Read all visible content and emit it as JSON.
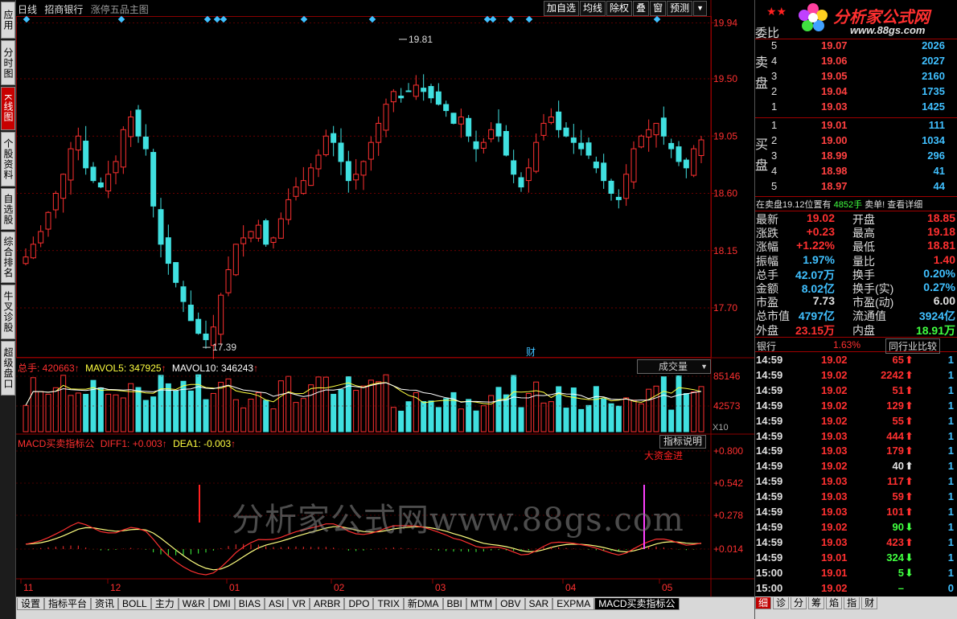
{
  "sidebar": {
    "items": [
      {
        "label": "应用",
        "active": false
      },
      {
        "label": "分时图",
        "active": false
      },
      {
        "label": "K线图",
        "active": true
      },
      {
        "label": "个股资料",
        "active": false
      },
      {
        "label": "自选股",
        "active": false
      },
      {
        "label": "综合排名",
        "active": false
      },
      {
        "label": "牛叉诊股",
        "active": false
      },
      {
        "label": "超级盘口",
        "active": false
      }
    ]
  },
  "header": {
    "period": "日线",
    "stock_name": "招商银行",
    "template_name": "涨停五品主图"
  },
  "toolbar": {
    "buttons": [
      "加自选",
      "均线",
      "除权",
      "叠",
      "窗",
      "预测"
    ],
    "dropdown_icon": "triangle-down-icon"
  },
  "price_axis": [
    "19.94",
    "19.50",
    "19.05",
    "18.60",
    "18.15",
    "17.70"
  ],
  "price_annotations": {
    "high_label": "19.81",
    "low_label": "17.39",
    "finance_marker": "财"
  },
  "volume_panel": {
    "label": "总手: 420663",
    "mavol5": "MAVOL5: 347925",
    "mavol10": "MAVOL10: 346243",
    "axis": [
      "85146",
      "42573"
    ],
    "unit": "X10",
    "selector": "成交量"
  },
  "macd_panel": {
    "label": "MACD买卖指标公",
    "diff": "DIFF1: +0.003",
    "dea": "DEA1: -0.003",
    "axis": [
      "+0.800",
      "+0.542",
      "+0.278",
      "+0.014"
    ],
    "help_button": "指标说明",
    "signal_text": "大资金进",
    "watermark": "分析家公式网www.88gs.com"
  },
  "x_axis": [
    "11",
    "12",
    "01",
    "02",
    "03",
    "04",
    "05"
  ],
  "bottom_tabs": [
    "设置",
    "指标平台",
    "资讯",
    "BOLL",
    "主力",
    "W&R",
    "DMI",
    "BIAS",
    "ASI",
    "VR",
    "ARBR",
    "DPO",
    "TRIX",
    "新DMA",
    "BBI",
    "MTM",
    "OBV",
    "SAR",
    "EXPMA",
    "MACD买卖指标公"
  ],
  "bottom_tabs_active": "MACD买卖指标公",
  "brand": {
    "name": "分析家公式网",
    "url": "www.88gs.com",
    "stars": "★★"
  },
  "order_book": {
    "commission_label": "委比",
    "sell_label": "卖盘",
    "buy_label": "买盘",
    "asks": [
      {
        "level": "5",
        "price": "19.07",
        "volume": "2026"
      },
      {
        "level": "4",
        "price": "19.06",
        "volume": "2027"
      },
      {
        "level": "3",
        "price": "19.05",
        "volume": "2160"
      },
      {
        "level": "2",
        "price": "19.04",
        "volume": "1735"
      },
      {
        "level": "1",
        "price": "19.03",
        "volume": "1425"
      }
    ],
    "bids": [
      {
        "level": "1",
        "price": "19.01",
        "volume": "111"
      },
      {
        "level": "2",
        "price": "19.00",
        "volume": "1034"
      },
      {
        "level": "3",
        "price": "18.99",
        "volume": "296"
      },
      {
        "level": "4",
        "price": "18.98",
        "volume": "41"
      },
      {
        "level": "5",
        "price": "18.97",
        "volume": "44"
      }
    ],
    "notice_prefix": "在卖盘19.12位置有",
    "notice_volume": "4852手",
    "notice_suffix": "卖单!",
    "notice_link": "查看详细"
  },
  "quote": [
    {
      "label": "最新",
      "value": "19.02",
      "color": "red",
      "label2": "开盘",
      "value2": "18.85",
      "color2": "red"
    },
    {
      "label": "涨跌",
      "value": "+0.23",
      "color": "red",
      "label2": "最高",
      "value2": "19.18",
      "color2": "red"
    },
    {
      "label": "涨幅",
      "value": "+1.22%",
      "color": "red",
      "label2": "最低",
      "value2": "18.81",
      "color2": "red"
    },
    {
      "label": "振幅",
      "value": "1.97%",
      "color": "cyan",
      "label2": "量比",
      "value2": "1.40",
      "color2": "red"
    },
    {
      "label": "总手",
      "value": "42.07万",
      "color": "cyan",
      "label2": "换手",
      "value2": "0.20%",
      "color2": "cyan"
    },
    {
      "label": "金额",
      "value": "8.02亿",
      "color": "cyan",
      "label2": "换手(实)",
      "value2": "0.27%",
      "color2": "cyan"
    },
    {
      "label": "市盈",
      "value": "7.73",
      "color": "white",
      "label2": "市盈(动)",
      "value2": "6.00",
      "color2": "white"
    },
    {
      "label": "总市值",
      "value": "4797亿",
      "color": "cyan",
      "label2": "流通值",
      "value2": "3924亿",
      "color2": "cyan"
    },
    {
      "label": "外盘",
      "value": "23.15万",
      "color": "red",
      "label2": "内盘",
      "value2": "18.91万",
      "color2": "green"
    }
  ],
  "sector": {
    "name": "银行",
    "change": "1.63%",
    "compare_button": "同行业比较"
  },
  "ticks": [
    {
      "time": "14:59",
      "price": "19.02",
      "volume": "65",
      "dir": "up",
      "count": "1"
    },
    {
      "time": "14:59",
      "price": "19.02",
      "volume": "2242",
      "dir": "up",
      "count": "1"
    },
    {
      "time": "14:59",
      "price": "19.02",
      "volume": "51",
      "dir": "up",
      "count": "1"
    },
    {
      "time": "14:59",
      "price": "19.02",
      "volume": "129",
      "dir": "up",
      "count": "1"
    },
    {
      "time": "14:59",
      "price": "19.02",
      "volume": "55",
      "dir": "up",
      "count": "1"
    },
    {
      "time": "14:59",
      "price": "19.03",
      "volume": "444",
      "dir": "up",
      "count": "1"
    },
    {
      "time": "14:59",
      "price": "19.03",
      "volume": "179",
      "dir": "up",
      "count": "1"
    },
    {
      "time": "14:59",
      "price": "19.02",
      "volume": "40",
      "dir": "neutral",
      "count": "1"
    },
    {
      "time": "14:59",
      "price": "19.03",
      "volume": "117",
      "dir": "up",
      "count": "1"
    },
    {
      "time": "14:59",
      "price": "19.03",
      "volume": "59",
      "dir": "up",
      "count": "1"
    },
    {
      "time": "14:59",
      "price": "19.03",
      "volume": "101",
      "dir": "up",
      "count": "1"
    },
    {
      "time": "14:59",
      "price": "19.02",
      "volume": "90",
      "dir": "down",
      "count": "1"
    },
    {
      "time": "14:59",
      "price": "19.03",
      "volume": "423",
      "dir": "up",
      "count": "1"
    },
    {
      "time": "14:59",
      "price": "19.01",
      "volume": "324",
      "dir": "down",
      "count": "1"
    },
    {
      "time": "15:00",
      "price": "19.01",
      "volume": "5",
      "dir": "down",
      "count": "1"
    },
    {
      "time": "15:00",
      "price": "19.02",
      "volume": "–",
      "dir": "none",
      "count": "0"
    }
  ],
  "right_tabs": [
    "细",
    "诊",
    "分",
    "筹",
    "焰",
    "指",
    "财"
  ],
  "right_tabs_active": "细",
  "colors": {
    "up": "#ff3030",
    "down": "#40ff40",
    "cyan": "#40c0ff",
    "grid": "#8b0000",
    "bg": "#000000"
  },
  "chart_data": {
    "type": "candlestick",
    "title": "招商银行 日线",
    "price_range": [
      17.39,
      19.94
    ],
    "high": 19.81,
    "low": 17.39,
    "months": [
      "11",
      "12",
      "01",
      "02",
      "03",
      "04",
      "05"
    ],
    "close_path": [
      18.1,
      18.2,
      18.3,
      18.45,
      18.6,
      18.75,
      18.95,
      19.05,
      18.8,
      18.7,
      18.65,
      18.75,
      18.85,
      19.1,
      19.2,
      19.05,
      18.95,
      18.5,
      18.2,
      18.05,
      17.9,
      17.75,
      17.6,
      17.5,
      17.45,
      17.55,
      17.8,
      18.0,
      18.2,
      18.25,
      18.3,
      18.35,
      18.2,
      18.25,
      18.4,
      18.55,
      18.65,
      18.7,
      18.8,
      18.9,
      19.05,
      19.0,
      18.85,
      18.7,
      18.75,
      18.85,
      19.0,
      19.15,
      19.3,
      19.4,
      19.35,
      19.4,
      19.45,
      19.4,
      19.35,
      19.3,
      19.25,
      19.15,
      19.2,
      19.05,
      18.95,
      19.0,
      19.1,
      19.05,
      18.9,
      18.75,
      18.65,
      18.8,
      19.0,
      19.15,
      19.2,
      19.1,
      19.05,
      19.0,
      18.95,
      18.9,
      18.8,
      18.7,
      18.6,
      18.55,
      18.75,
      18.95,
      19.05,
      19.1,
      19.15,
      19.05,
      18.95,
      18.85,
      18.8,
      18.95,
      19.02
    ],
    "volume_series": [
      "总手",
      "MAVOL5",
      "MAVOL10"
    ],
    "macd_series": [
      "DIFF1",
      "DEA1"
    ],
    "macd_range": [
      0.014,
      0.8
    ]
  }
}
